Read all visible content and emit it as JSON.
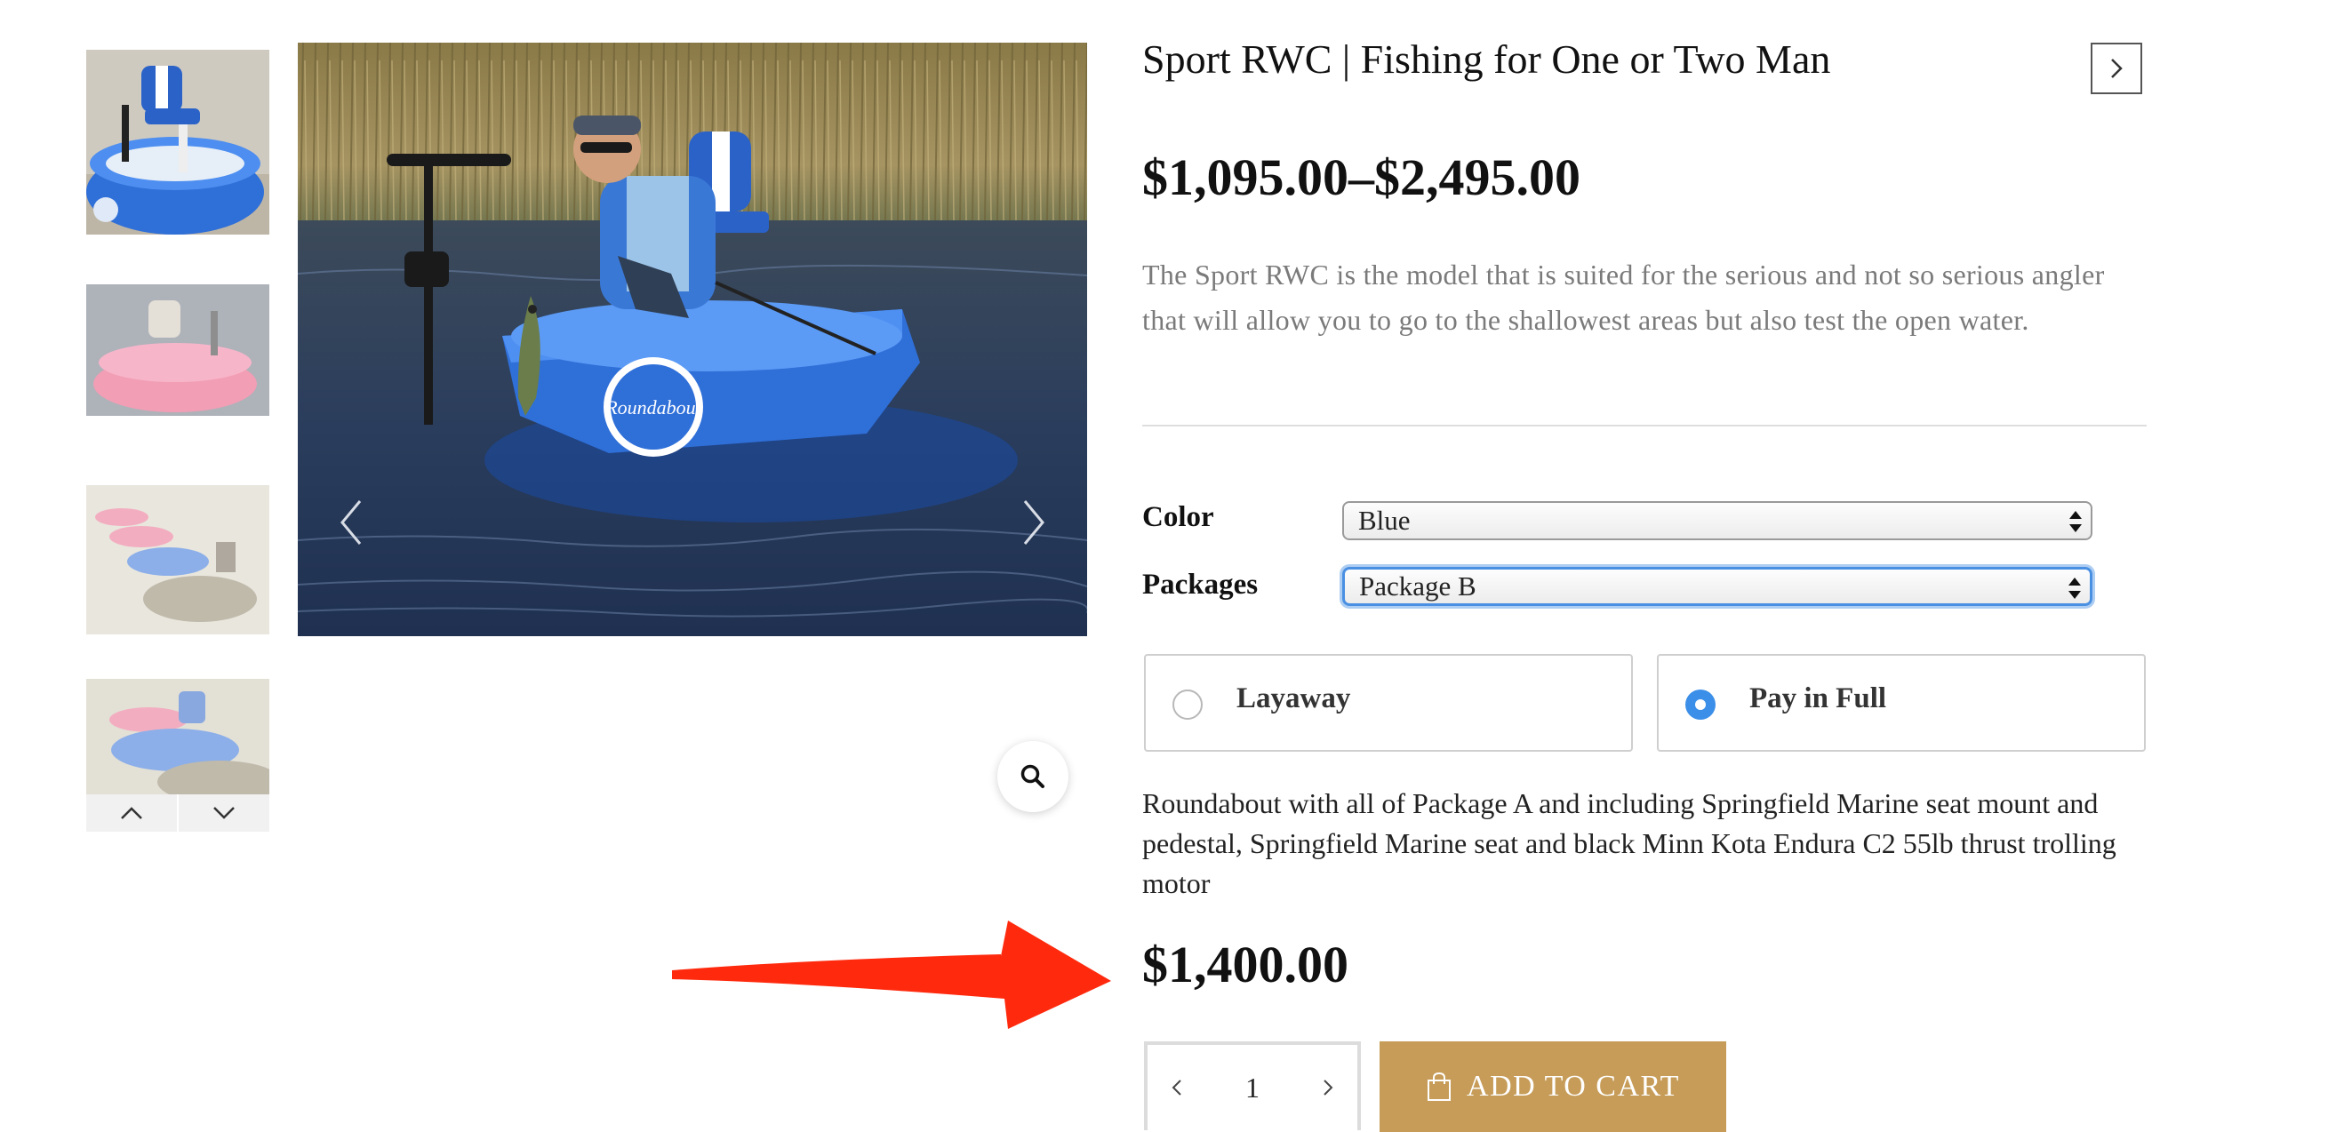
{
  "product": {
    "title": "Sport RWC | Fishing for One or Two Man",
    "price_range": "$1,095.00–$2,495.00",
    "short_description": "The Sport RWC is the model that is suited for the serious and not so serious angler that will allow you to go to the shallowest areas but also test the open water."
  },
  "gallery": {
    "thumbnails": [
      {
        "icon": "boat-blue-seat-thumbnail"
      },
      {
        "icon": "boat-pink-thumbnail"
      },
      {
        "icon": "boats-beach-thumbnail"
      },
      {
        "icon": "boats-beach-closeup-thumbnail"
      }
    ],
    "main_image_text": "Roundabout",
    "colors": {
      "accent": "#c69c58",
      "boat_blue": "#2f6fd8",
      "selection_blue": "#3b8fe8"
    }
  },
  "variations": {
    "color": {
      "label": "Color",
      "selected": "Blue"
    },
    "packages": {
      "label": "Packages",
      "selected": "Package B"
    }
  },
  "payment": {
    "layaway_label": "Layaway",
    "pay_in_full_label": "Pay in Full",
    "selected": "Pay in Full"
  },
  "variation_description": "Roundabout with all of Package A and including Springfield Marine seat mount and pedestal, Springfield Marine seat and black Minn Kota Endura C2 55lb thrust trolling motor",
  "variation_price": "$1,400.00",
  "cart": {
    "quantity": "1",
    "add_to_cart_label": "ADD TO CART"
  }
}
